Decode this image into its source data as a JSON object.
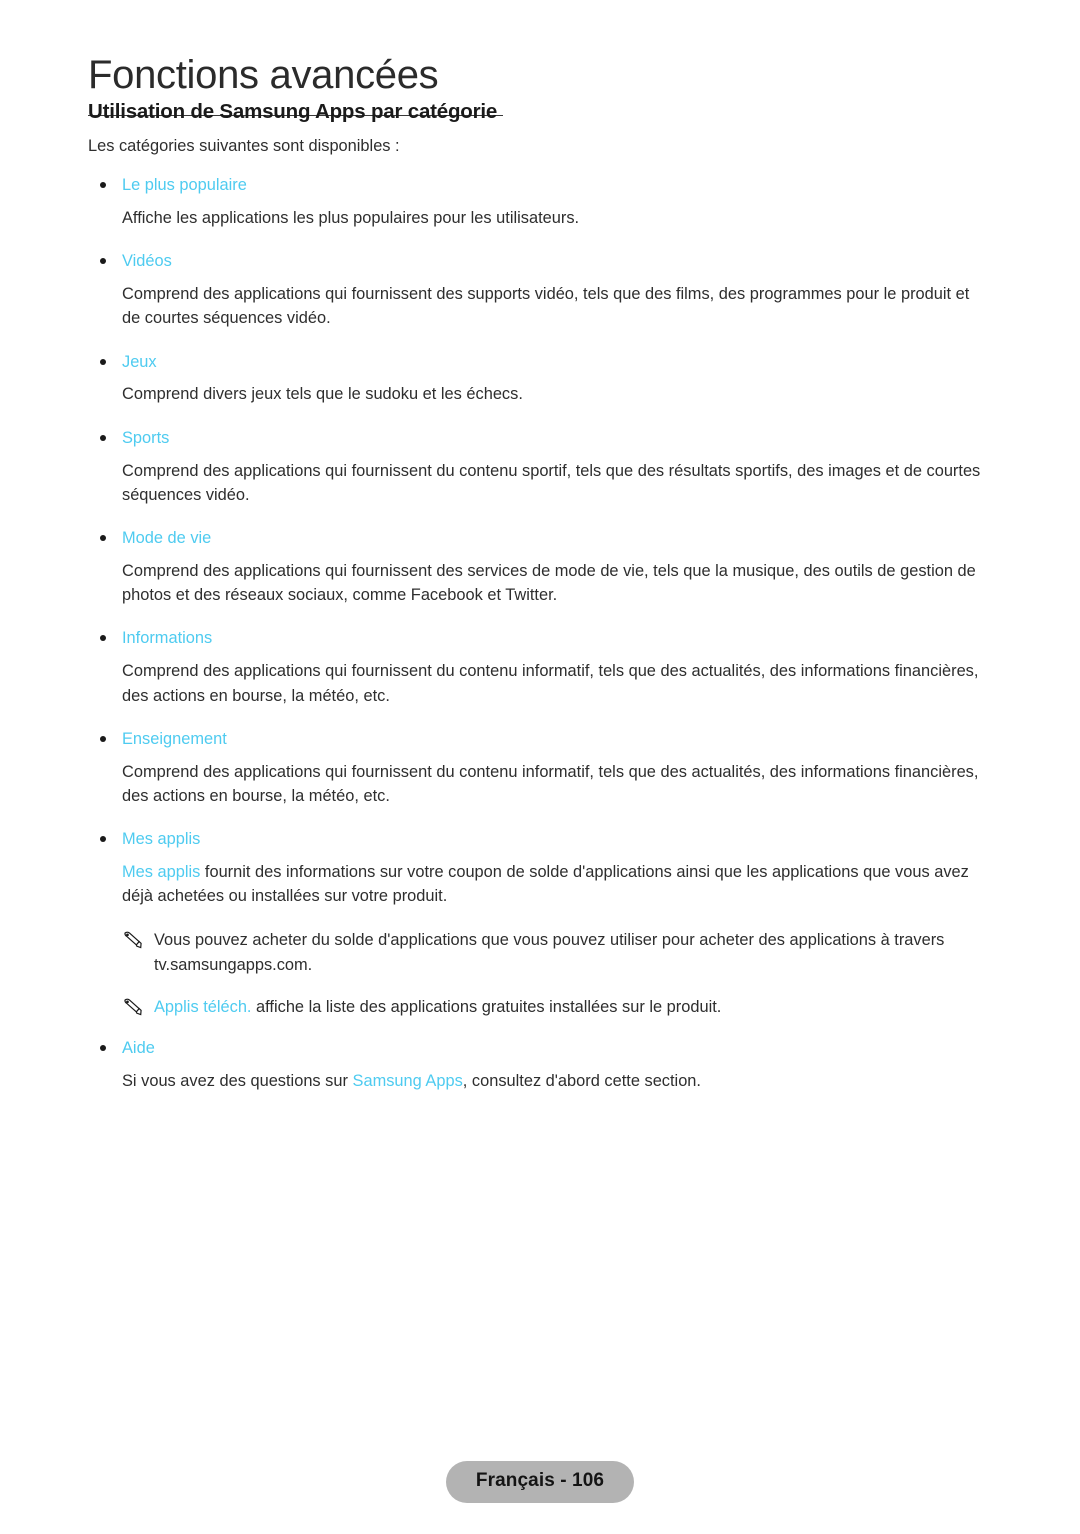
{
  "page": {
    "chapter_title": "Fonctions avancées",
    "section_heading": "Utilisation de Samsung Apps par catégorie",
    "intro": "Les catégories suivantes sont disponibles :",
    "accent_color": "#4ecbf0",
    "body_color": "#2e2e2e"
  },
  "categories": [
    {
      "term": "Le plus populaire",
      "description": "Affiche les applications les plus populaires pour les utilisateurs."
    },
    {
      "term": "Vidéos",
      "description": "Comprend des applications qui fournissent des supports vidéo, tels que des films, des programmes pour le produit et de courtes séquences vidéo."
    },
    {
      "term": "Jeux",
      "description": "Comprend divers jeux tels que le sudoku et les échecs."
    },
    {
      "term": "Sports",
      "description": "Comprend des applications qui fournissent du contenu sportif, tels que des résultats sportifs, des images et de courtes séquences vidéo."
    },
    {
      "term": "Mode de vie",
      "description": "Comprend des applications qui fournissent des services de mode de vie, tels que la musique, des outils de gestion de photos et des réseaux sociaux, comme Facebook et Twitter."
    },
    {
      "term": "Informations",
      "description": "Comprend des applications qui fournissent du contenu informatif, tels que des actualités, des informations financières, des actions en bourse, la météo, etc."
    },
    {
      "term": "Enseignement",
      "description": "Comprend des applications qui fournissent du contenu informatif, tels que des actualités, des informations financières, des actions en bourse, la météo, etc."
    }
  ],
  "mes_applis": {
    "term": "Mes applis",
    "desc_link": "Mes applis",
    "desc_rest": " fournit des informations sur votre coupon de solde d'applications ainsi que les applications que vous avez déjà achetées ou installées sur votre produit.",
    "notes": [
      {
        "icon": "pencil-icon",
        "text": "Vous pouvez acheter du solde d'applications que vous pouvez utiliser pour acheter des applications à travers tv.samsungapps.com.",
        "link": ""
      },
      {
        "icon": "pencil-icon",
        "link": "Applis téléch.",
        "text": " affiche la liste des applications gratuites installées sur le produit."
      }
    ]
  },
  "aide": {
    "term": "Aide",
    "desc_before": "Si vous avez des questions sur ",
    "desc_link": "Samsung Apps",
    "desc_after": ", consultez d'abord cette section."
  },
  "footer": {
    "label": "Français - 106"
  }
}
